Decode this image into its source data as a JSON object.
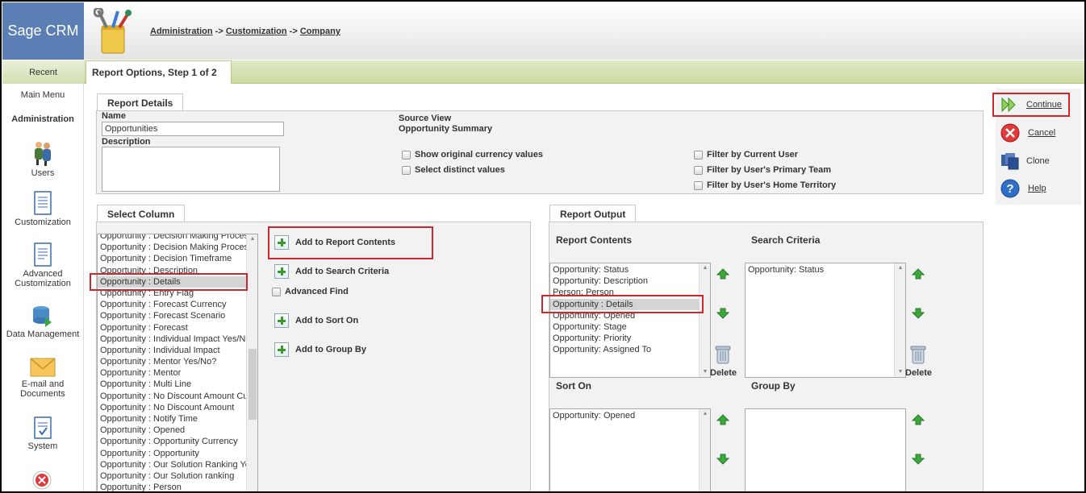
{
  "app": {
    "logo": "Sage CRM"
  },
  "breadcrumb": {
    "item1": "Administration",
    "sep1": " -> ",
    "item2": "Customization",
    "sep2": " -> ",
    "item3": "Company"
  },
  "tabs": {
    "recent": "Recent",
    "current": "Report Options, Step 1 of 2"
  },
  "sidebar": {
    "main_menu": "Main Menu",
    "section": "Administration",
    "items": [
      {
        "label": "Users",
        "icon": "users-icon"
      },
      {
        "label": "Customization",
        "icon": "customization-icon"
      },
      {
        "label": "Advanced Customization",
        "icon": "advanced-customization-icon"
      },
      {
        "label": "Data Management",
        "icon": "data-management-icon"
      },
      {
        "label": "E-mail and Documents",
        "icon": "email-icon"
      },
      {
        "label": "System",
        "icon": "system-icon"
      }
    ]
  },
  "report_details": {
    "tab": "Report Details",
    "name_label": "Name",
    "name_value": "Opportunities",
    "description_label": "Description",
    "description_value": "",
    "source_view_label": "Source View",
    "source_view_value": "Opportunity Summary",
    "options": [
      "Show original currency values",
      "Select distinct values",
      "Filter by Current User",
      "Filter by User's Primary Team",
      "Filter by User's Home Territory"
    ]
  },
  "select_column": {
    "tab": "Select Column",
    "items": [
      "Opportunity : Decision Making Process",
      "Opportunity : Decision Making Process",
      "Opportunity : Decision Timeframe",
      "Opportunity : Description",
      "Opportunity : Details",
      "Opportunity : Entry Flag",
      "Opportunity : Forecast Currency",
      "Opportunity : Forecast Scenario",
      "Opportunity : Forecast",
      "Opportunity : Individual Impact Yes/No?",
      "Opportunity : Individual Impact",
      "Opportunity : Mentor Yes/No?",
      "Opportunity : Mentor",
      "Opportunity : Multi Line",
      "Opportunity : No Discount Amount Currency",
      "Opportunity : No Discount Amount",
      "Opportunity : Notify Time",
      "Opportunity : Opened",
      "Opportunity : Opportunity Currency",
      "Opportunity : Opportunity",
      "Opportunity : Our Solution Ranking Yes/No?",
      "Opportunity : Our Solution ranking",
      "Opportunity : Person"
    ],
    "selected_index": 4
  },
  "actions": {
    "add_report_contents": "Add to Report Contents",
    "add_search_criteria": "Add to Search Criteria",
    "advanced_find": "Advanced Find",
    "add_sort_on": "Add to Sort On",
    "add_group_by": "Add to Group By"
  },
  "report_output": {
    "tab": "Report Output",
    "report_contents_label": "Report Contents",
    "report_contents": [
      "Opportunity: Status",
      "Opportunity: Description",
      "Person: Person",
      "Opportunity : Details",
      "Opportunity: Opened",
      "Opportunity: Stage",
      "Opportunity: Priority",
      "Opportunity: Assigned To"
    ],
    "report_contents_selected": 3,
    "search_criteria_label": "Search Criteria",
    "search_criteria": [
      "Opportunity: Status"
    ],
    "sort_on_label": "Sort On",
    "sort_on": [
      "Opportunity: Opened"
    ],
    "group_by_label": "Group By",
    "group_by": [],
    "delete_label": "Delete"
  },
  "right_actions": {
    "continue": "Continue",
    "cancel": "Cancel",
    "clone": "Clone",
    "help": "Help"
  },
  "colors": {
    "logo_bg": "#5b7fb4",
    "highlight": "#d0262c",
    "green_bar": "#c9da9e"
  }
}
